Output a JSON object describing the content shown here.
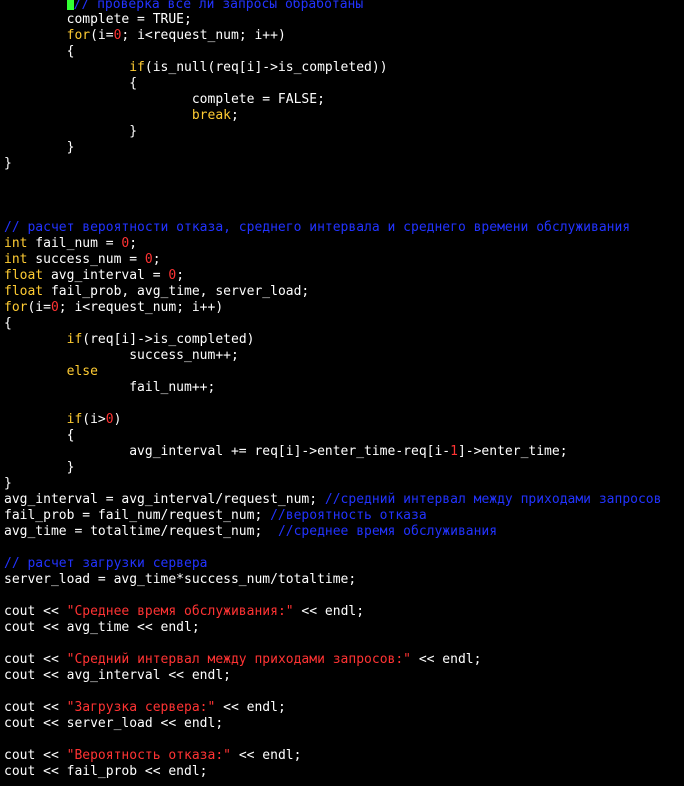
{
  "editor": {
    "colors": {
      "background": "#000000",
      "text": "#ffffff",
      "keyword": "#ffcc33",
      "number_string": "#ff3333",
      "comment": "#2233ff",
      "cursor": "#33ff33"
    },
    "lines": [
      [
        {
          "t": "        "
        },
        {
          "t": "",
          "c": "cursor"
        },
        {
          "t": "// проверка все ли запросы обработаны",
          "c": "cm"
        }
      ],
      [
        {
          "t": "        complete = TRUE;"
        }
      ],
      [
        {
          "t": "        "
        },
        {
          "t": "for",
          "c": "kw"
        },
        {
          "t": "(i="
        },
        {
          "t": "0",
          "c": "num"
        },
        {
          "t": "; i<request_num; i++)"
        }
      ],
      [
        {
          "t": "        {"
        }
      ],
      [
        {
          "t": "                "
        },
        {
          "t": "if",
          "c": "kw"
        },
        {
          "t": "(is_null(req[i]->is_completed))"
        }
      ],
      [
        {
          "t": "                {"
        }
      ],
      [
        {
          "t": "                        complete = FALSE;"
        }
      ],
      [
        {
          "t": "                        "
        },
        {
          "t": "break",
          "c": "kw"
        },
        {
          "t": ";"
        }
      ],
      [
        {
          "t": "                }"
        }
      ],
      [
        {
          "t": "        }"
        }
      ],
      [
        {
          "t": "}"
        }
      ],
      [
        {
          "t": ""
        }
      ],
      [
        {
          "t": ""
        }
      ],
      [
        {
          "t": ""
        }
      ],
      [
        {
          "t": "// расчет вероятности отказа, среднего интервала и среднего времени обслуживания",
          "c": "cm"
        }
      ],
      [
        {
          "t": "int",
          "c": "kw"
        },
        {
          "t": " fail_num = "
        },
        {
          "t": "0",
          "c": "num"
        },
        {
          "t": ";"
        }
      ],
      [
        {
          "t": "int",
          "c": "kw"
        },
        {
          "t": " success_num = "
        },
        {
          "t": "0",
          "c": "num"
        },
        {
          "t": ";"
        }
      ],
      [
        {
          "t": "float",
          "c": "kw"
        },
        {
          "t": " avg_interval = "
        },
        {
          "t": "0",
          "c": "num"
        },
        {
          "t": ";"
        }
      ],
      [
        {
          "t": "float",
          "c": "kw"
        },
        {
          "t": " fail_prob, avg_time, server_load;"
        }
      ],
      [
        {
          "t": "for",
          "c": "kw"
        },
        {
          "t": "(i="
        },
        {
          "t": "0",
          "c": "num"
        },
        {
          "t": "; i<request_num; i++)"
        }
      ],
      [
        {
          "t": "{"
        }
      ],
      [
        {
          "t": "        "
        },
        {
          "t": "if",
          "c": "kw"
        },
        {
          "t": "(req[i]->is_completed)"
        }
      ],
      [
        {
          "t": "                success_num++;"
        }
      ],
      [
        {
          "t": "        "
        },
        {
          "t": "else",
          "c": "kw"
        }
      ],
      [
        {
          "t": "                fail_num++;"
        }
      ],
      [
        {
          "t": ""
        }
      ],
      [
        {
          "t": "        "
        },
        {
          "t": "if",
          "c": "kw"
        },
        {
          "t": "(i>"
        },
        {
          "t": "0",
          "c": "num"
        },
        {
          "t": ")"
        }
      ],
      [
        {
          "t": "        {"
        }
      ],
      [
        {
          "t": "                avg_interval += req[i]->enter_time-req[i-"
        },
        {
          "t": "1",
          "c": "num"
        },
        {
          "t": "]->enter_time;"
        }
      ],
      [
        {
          "t": "        }"
        }
      ],
      [
        {
          "t": "}"
        }
      ],
      [
        {
          "t": "avg_interval = avg_interval/request_num; "
        },
        {
          "t": "//средний интервал между приходами запросов",
          "c": "cm"
        }
      ],
      [
        {
          "t": "fail_prob = fail_num/request_num; "
        },
        {
          "t": "//вероятность отказа",
          "c": "cm"
        }
      ],
      [
        {
          "t": "avg_time = totaltime/request_num;  "
        },
        {
          "t": "//среднее время обслуживания",
          "c": "cm"
        }
      ],
      [
        {
          "t": ""
        }
      ],
      [
        {
          "t": "// расчет загрузки сервера",
          "c": "cm"
        }
      ],
      [
        {
          "t": "server_load = avg_time*success_num/totaltime;"
        }
      ],
      [
        {
          "t": ""
        }
      ],
      [
        {
          "t": "cout << "
        },
        {
          "t": "\"Среднее время обслуживания:\"",
          "c": "str"
        },
        {
          "t": " << endl;"
        }
      ],
      [
        {
          "t": "cout << avg_time << endl;"
        }
      ],
      [
        {
          "t": ""
        }
      ],
      [
        {
          "t": "cout << "
        },
        {
          "t": "\"Средний интервал между приходами запросов:\"",
          "c": "str"
        },
        {
          "t": " << endl;"
        }
      ],
      [
        {
          "t": "cout << avg_interval << endl;"
        }
      ],
      [
        {
          "t": ""
        }
      ],
      [
        {
          "t": "cout << "
        },
        {
          "t": "\"Загрузка сервера:\"",
          "c": "str"
        },
        {
          "t": " << endl;"
        }
      ],
      [
        {
          "t": "cout << server_load << endl;"
        }
      ],
      [
        {
          "t": ""
        }
      ],
      [
        {
          "t": "cout << "
        },
        {
          "t": "\"Вероятность отказа:\"",
          "c": "str"
        },
        {
          "t": " << endl;"
        }
      ],
      [
        {
          "t": "cout << fail_prob << endl;"
        }
      ]
    ]
  }
}
